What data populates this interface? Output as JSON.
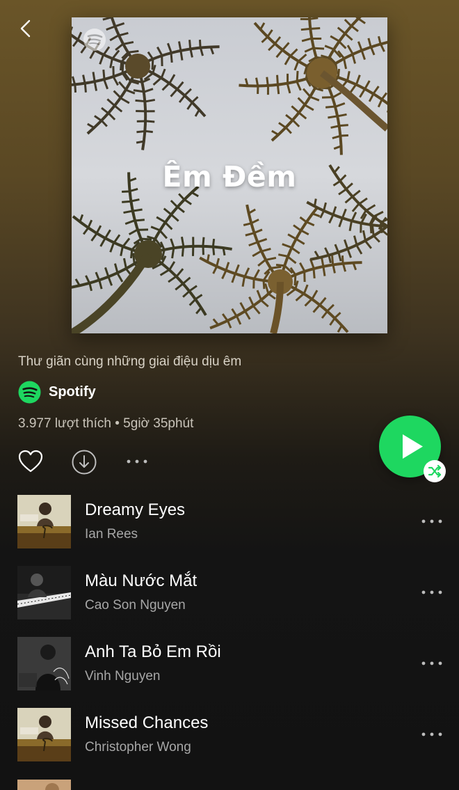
{
  "header": {
    "back_icon": "chevron-left-icon"
  },
  "cover": {
    "title": "Êm Đềm",
    "logo_icon": "spotify-logo-icon"
  },
  "playlist": {
    "description": "Thư giãn cùng những giai điệu dịu êm",
    "owner": "Spotify",
    "stats": "3.977 lượt thích • 5giờ 35phút"
  },
  "actions": {
    "like_icon": "heart-outline-icon",
    "download_icon": "download-icon",
    "more_icon": "more-horizontal-icon",
    "play_icon": "play-icon",
    "shuffle_icon": "shuffle-icon"
  },
  "colors": {
    "accent": "#1ed760",
    "background": "#121212",
    "header_gradient": "#6a5528",
    "secondary_text": "#a7a7a7"
  },
  "tracks": [
    {
      "title": "Dreamy Eyes",
      "artist": "Ian Rees"
    },
    {
      "title": "Màu Nước Mắt",
      "artist": "Cao Son Nguyen"
    },
    {
      "title": "Anh Ta Bỏ Em Rồi",
      "artist": "Vinh Nguyen"
    },
    {
      "title": "Missed Chances",
      "artist": "Christopher Wong"
    }
  ]
}
